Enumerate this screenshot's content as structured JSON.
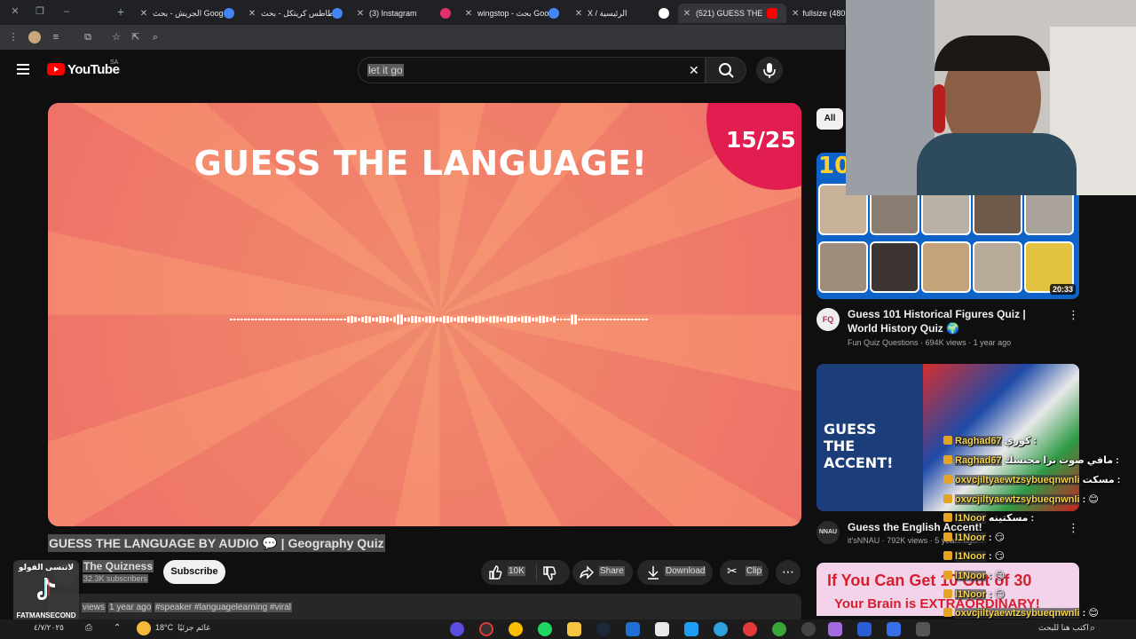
{
  "browser": {
    "tabs": [
      {
        "label": "الجريش - بحث Google",
        "favicon_color": "#4285f4"
      },
      {
        "label": "بطاطس كريتكل - بحث",
        "favicon_color": "#4285f4"
      },
      {
        "label": "(3) Instagram",
        "favicon_color": "#e1306c"
      },
      {
        "label": "wingstop - بحث Goo",
        "favicon_color": "#4285f4"
      },
      {
        "label": "X / الرئيسية",
        "favicon_color": "#ffffff"
      },
      {
        "label": "(521) GUESS THE",
        "favicon_color": "#ff0000"
      },
      {
        "label": "fullsize (480",
        "favicon_color": "#888888"
      }
    ],
    "new_tab_symbol": "+"
  },
  "youtube": {
    "logo_text": "YouTube",
    "country_code": "SA",
    "search": {
      "value": "let it go"
    },
    "video": {
      "overlay_title": "GUESS THE LANGUAGE!",
      "counter": "15/25"
    },
    "title": "GUESS THE LANGUAGE BY AUDIO 💬 | Geography Quiz",
    "channel": {
      "name": "The Quizness",
      "subscribers": "32.3K subscribers"
    },
    "subscribe_label": "Subscribe",
    "actions": {
      "likes": "10K",
      "share": "Share",
      "download": "Download",
      "clip": "Clip"
    },
    "description_line": {
      "views": "views",
      "age": "1 year ago",
      "tags": "#speaker #languagelearning #viral"
    },
    "filter_chip": "All",
    "recommendations": [
      {
        "thumb_text": "101",
        "duration": "20:33",
        "title": "Guess 101 Historical Figures Quiz | World History Quiz 🌍",
        "channel": "Fun Quiz Questions",
        "views": "694K views",
        "age": "1 year ago",
        "channel_abbr": "FQ"
      },
      {
        "thumb_text": "GUESS THE ACCENT!",
        "title": "Guess the English Accent!",
        "channel": "it'sNNAU",
        "views": "792K views",
        "age": "5 years ago",
        "channel_abbr": "NNAU"
      },
      {
        "thumb_text_line1": "If You Can Get 10 Out of 30",
        "thumb_text_line2": "Your Brain is EXTRAORDINARY!"
      }
    ]
  },
  "stream_overlay": {
    "chat": [
      {
        "name": "Raghad67",
        "msg": "كوري : "
      },
      {
        "name": "Raghad67",
        "msg": "مافي صوت ترا مجنسك : "
      },
      {
        "name": "oxvcjiltyaewtzsybueqnwnli",
        "msg": "مسكت : "
      },
      {
        "name": "oxvcjiltyaewtzsybueqnwnli",
        "msg": ": 😊"
      },
      {
        "name": "l1Noor",
        "msg": "مسكتينه : "
      },
      {
        "name": "l1Noor",
        "msg": ": 😏"
      },
      {
        "name": "l1Noor",
        "msg": ": 😏"
      },
      {
        "name": "l1Noor",
        "msg": ": 😏"
      },
      {
        "name": "l1Noor",
        "msg": ": 😏"
      },
      {
        "name": "oxvcjiltyaewtzsybueqnwnli",
        "msg": ": 😊"
      }
    ],
    "tiktok": {
      "top_text": "لاتنسى الفولو",
      "handle": "FATMANSECOND"
    }
  },
  "taskbar": {
    "weather": "18°C",
    "weather_text": "غائم جزئيًا",
    "search_placeholder": "اكتب هنا للبحث",
    "date": "٤/٧/٢٠٢٥"
  }
}
